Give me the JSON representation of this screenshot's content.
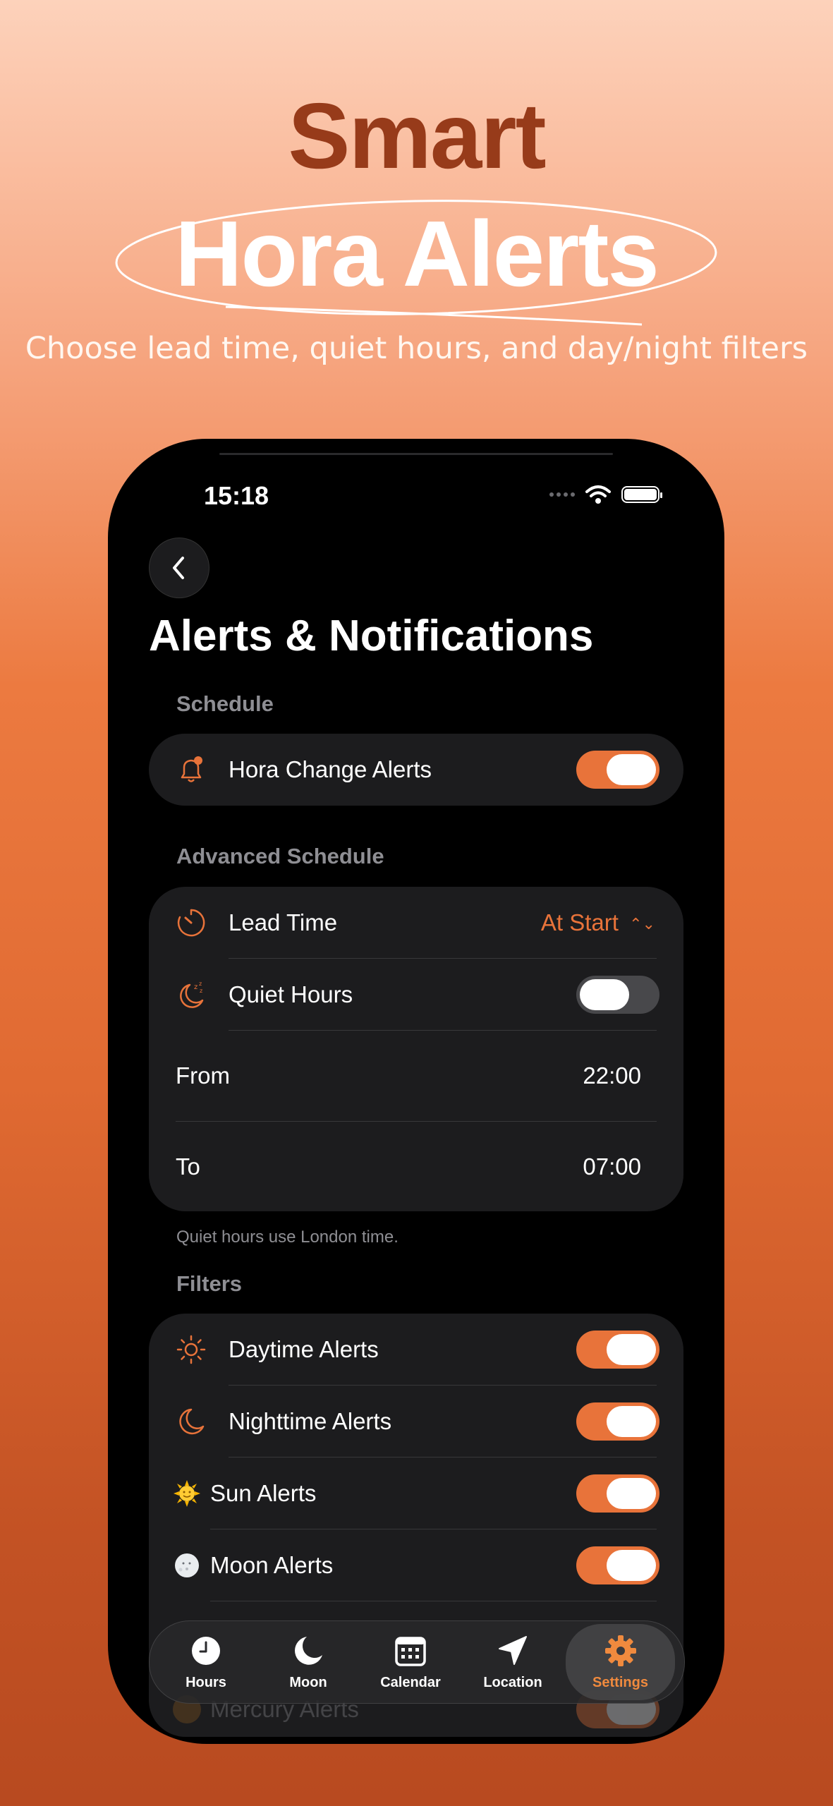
{
  "promo": {
    "title_line1": "Smart",
    "title_line2": "Hora Alerts",
    "subtitle": "Choose lead time, quiet hours, and day/night filters"
  },
  "status_bar": {
    "time": "15:18"
  },
  "page": {
    "title": "Alerts & Notifications"
  },
  "schedule": {
    "label": "Schedule",
    "hora_change": {
      "label": "Hora Change Alerts",
      "on": true
    }
  },
  "advanced": {
    "label": "Advanced Schedule",
    "lead_time": {
      "label": "Lead Time",
      "value": "At Start"
    },
    "quiet_hours": {
      "label": "Quiet Hours",
      "on": false
    },
    "from": {
      "label": "From",
      "value": "22:00"
    },
    "to": {
      "label": "To",
      "value": "07:00"
    },
    "footnote": "Quiet hours use London time."
  },
  "filters": {
    "label": "Filters",
    "items": [
      {
        "label": "Daytime Alerts",
        "icon": "sun-outline-icon",
        "on": true
      },
      {
        "label": "Nighttime Alerts",
        "icon": "moon-outline-icon",
        "on": true
      },
      {
        "label": "Sun Alerts",
        "icon": "sun-emoji-icon",
        "on": true
      },
      {
        "label": "Moon Alerts",
        "icon": "moon-emoji-icon",
        "on": true
      },
      {
        "label": "Mercury Alerts",
        "icon": "mercury-icon",
        "on": true
      }
    ]
  },
  "tabbar": {
    "tabs": [
      {
        "label": "Hours",
        "icon": "clock-icon",
        "active": false
      },
      {
        "label": "Moon",
        "icon": "moon-icon",
        "active": false
      },
      {
        "label": "Calendar",
        "icon": "calendar-icon",
        "active": false
      },
      {
        "label": "Location",
        "icon": "location-arrow-icon",
        "active": false
      },
      {
        "label": "Settings",
        "icon": "gear-icon",
        "active": true
      }
    ]
  },
  "colors": {
    "accent": "#e8733a",
    "card": "#1c1c1e",
    "brand_dark": "#973b1a"
  }
}
